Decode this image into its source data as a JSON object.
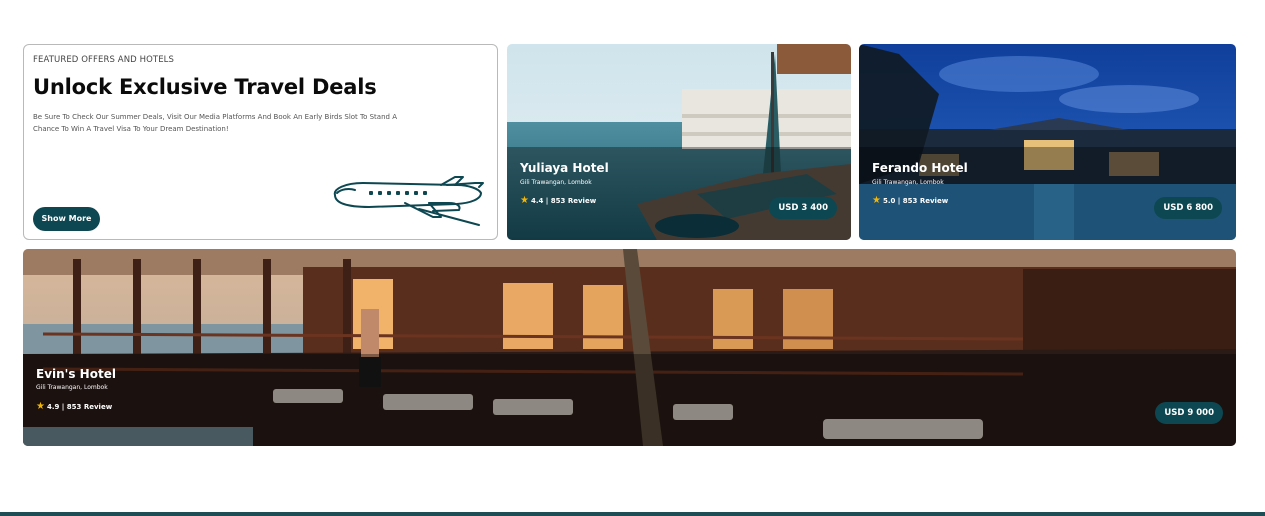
{
  "promo": {
    "eyebrow": "FEATURED OFFERS AND HOTELS",
    "title": "Unlock Exclusive Travel Deals",
    "description": "Be Sure To Check Our Summer Deals, Visit Our Media Platforms And Book An Early Birds Slot To Stand A Chance To Win A Travel Visa To Your Dream Destination!",
    "button_label": "Show More",
    "illustration_icon": "airplane-icon"
  },
  "hotels": [
    {
      "name": "Yuliaya Hotel",
      "location": "Gili Trawangan, Lombok",
      "rating_text": "4.4 | 853 Review",
      "price": "USD 3 400"
    },
    {
      "name": "Ferando Hotel",
      "location": "Gili Trawangan, Lombok",
      "rating_text": "5.0 | 853 Review",
      "price": "USD 6 800"
    },
    {
      "name": "Evin's Hotel",
      "location": "Gili Trawangan, Lombok",
      "rating_text": "4.9 | 853 Review",
      "price": "USD 9 000"
    }
  ],
  "star_icon": "star-icon",
  "colors": {
    "accent": "#0d4752",
    "star": "#f5b400"
  }
}
